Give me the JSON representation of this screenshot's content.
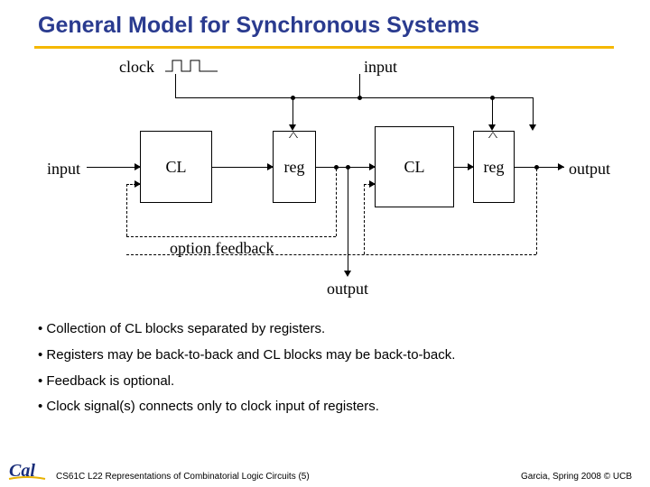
{
  "title": "General Model for Synchronous Systems",
  "diagram": {
    "clock_label": "clock",
    "input_top_label": "input",
    "input_left_label": "input",
    "output_label": "output",
    "cl_label": "CL",
    "reg_label": "reg",
    "feedback_label": "option feedback",
    "output_mid_label": "output"
  },
  "bullets": {
    "b1": "Collection of CL blocks separated by registers.",
    "b2": "Registers may be back-to-back and CL blocks may be back-to-back.",
    "b3": "Feedback is optional.",
    "b4": "Clock signal(s) connects only to clock input of registers."
  },
  "footer": {
    "left": "CS61C L22 Representations of Combinatorial Logic Circuits (5)",
    "right": "Garcia, Spring 2008 © UCB"
  },
  "logo_alt": "Cal"
}
